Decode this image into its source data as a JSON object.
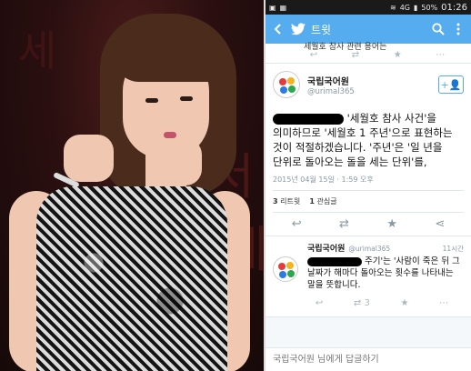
{
  "status_bar": {
    "network": "4G",
    "battery": "50%",
    "time": "01:26"
  },
  "app_bar": {
    "title": "트윗"
  },
  "top_tweet": {
    "text": "세월호 참사 관련 용어는"
  },
  "main_tweet": {
    "author_name": "국립국어원",
    "handle": "@urimal365",
    "body_parts": [
      "'세월호 참사 사건'을",
      "의미하므로 '세월호 1 주년'으로 표현하는",
      "것이 적절하겠습니다. '주년'은 '일 년을",
      "단위로 돌아오는 돌을 세는 단위'를,"
    ],
    "timestamp": "2015년 04월 15일 · 1:59 오후",
    "retweets_count": "3",
    "retweets_label": "리트윗",
    "favorites_count": "1",
    "favorites_label": "관심글"
  },
  "reply_tweet": {
    "author_name": "국립국어원",
    "handle": "@urimal365",
    "ago": "11시간",
    "body_after_redaction": "주기'는 '사람이 죽은 뒤 그 날짜가 해마다 돌아오는 횟수를 나타내는 말을 뜻합니다.",
    "retweets": "3"
  },
  "reply_box": {
    "placeholder": "국립국어원 님에게 답글하기"
  },
  "colors": {
    "twitter_blue": "#55acee",
    "action_gray": "#aab8c2"
  },
  "icons": [
    "back-arrow-icon",
    "twitter-bird-icon",
    "search-icon",
    "more-icon",
    "reply-icon",
    "retweet-icon",
    "favorite-icon",
    "share-icon",
    "follow-icon"
  ]
}
